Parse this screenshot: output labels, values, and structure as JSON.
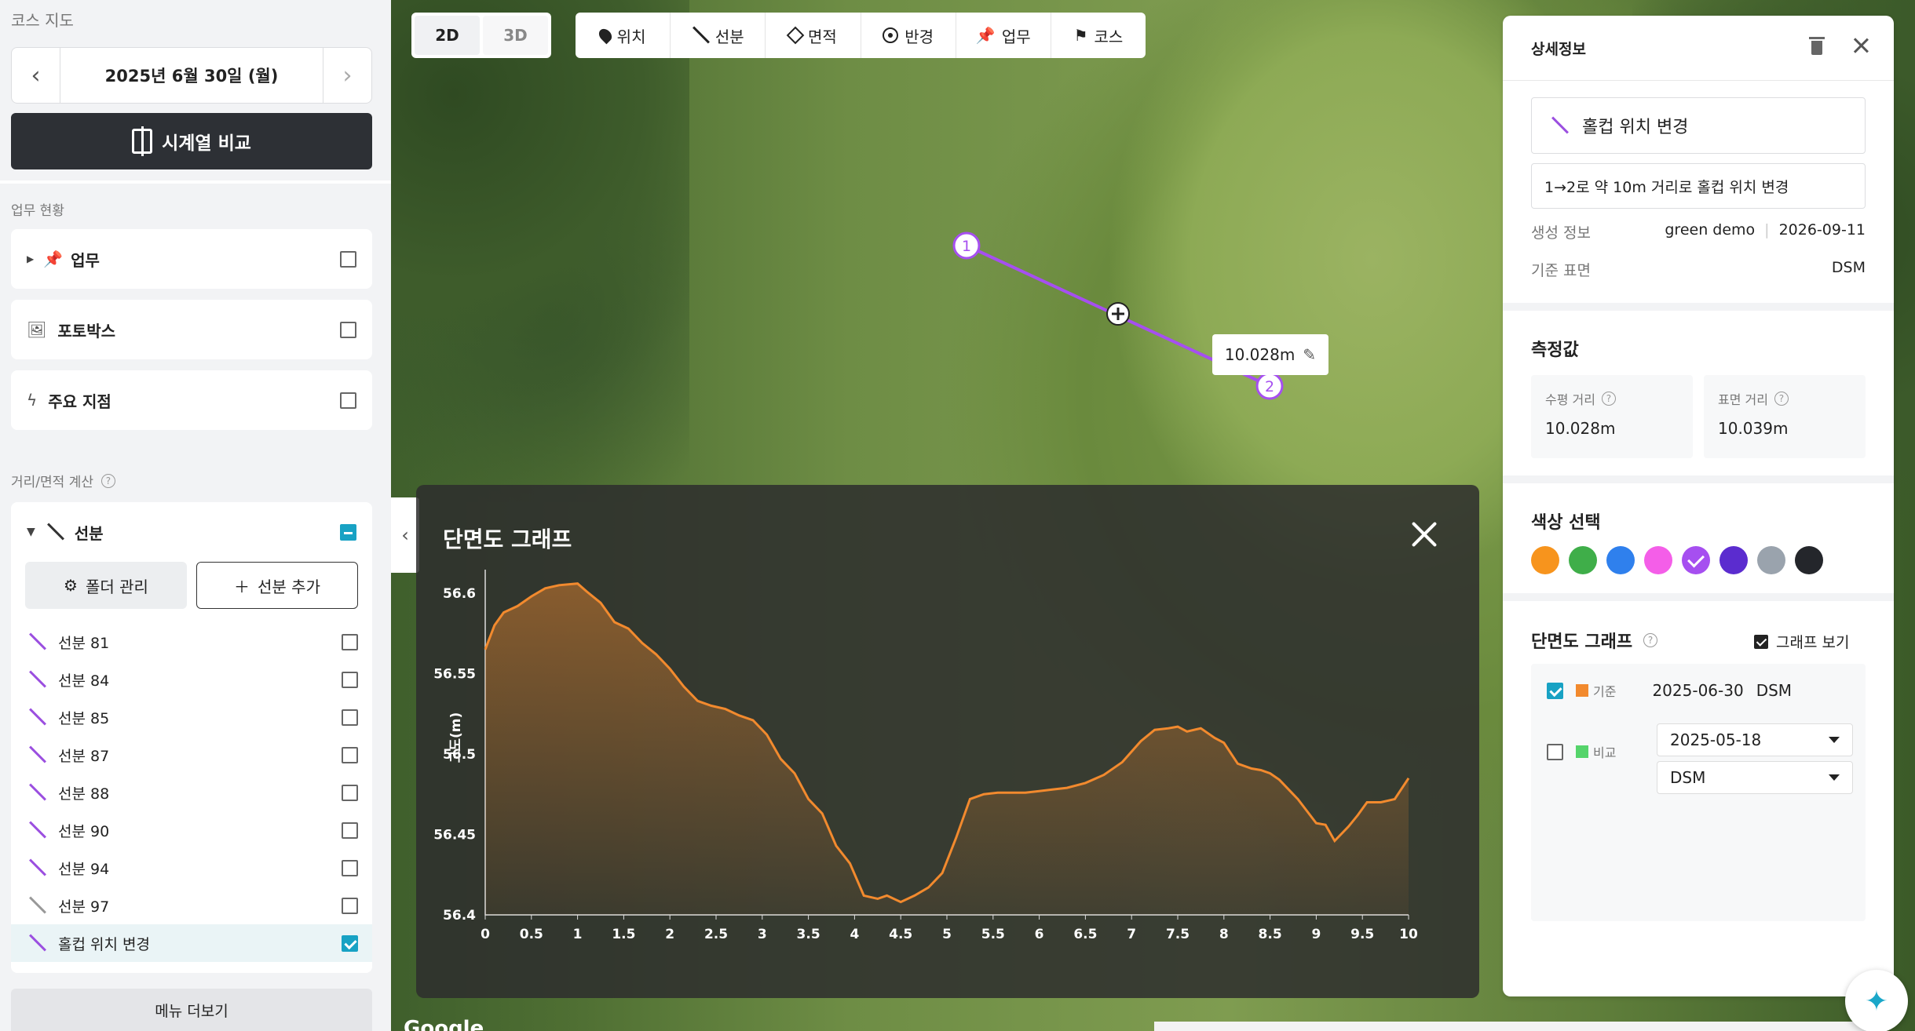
{
  "sidebar": {
    "title": "코스 지도",
    "date": "2025년 6월 30일 (월)",
    "compare_label": "시계열 비교",
    "work_status_label": "업무 현황",
    "cards": [
      {
        "label": "업무"
      },
      {
        "label": "포토박스"
      },
      {
        "label": "주요 지점"
      }
    ],
    "calc_label": "거리/면적 계산",
    "line_panel": {
      "title": "선분",
      "folder_btn": "폴더 관리",
      "add_btn": "선분 추가",
      "items": [
        {
          "name": "선분 81"
        },
        {
          "name": "선분 84"
        },
        {
          "name": "선분 85"
        },
        {
          "name": "선분 87"
        },
        {
          "name": "선분 88"
        },
        {
          "name": "선분 90"
        },
        {
          "name": "선분 94"
        },
        {
          "name": "선분 97"
        },
        {
          "name": "홀컵 위치 변경"
        }
      ]
    },
    "more_label": "메뉴 더보기"
  },
  "map": {
    "view_2d": "2D",
    "view_3d": "3D",
    "tools": [
      "위치",
      "선분",
      "면적",
      "반경",
      "업무",
      "코스"
    ],
    "markers": [
      "1",
      "2"
    ],
    "distance_tag": "10.028m",
    "google": "Google"
  },
  "graph": {
    "title": "단면도 그래프"
  },
  "chart_data": {
    "type": "area",
    "title": "단면도 그래프",
    "ylabel": "고도(m)",
    "xlabel": "",
    "xlim": [
      0,
      10
    ],
    "ylim": [
      56.4,
      56.6
    ],
    "x_ticks": [
      "0",
      "0.5",
      "1",
      "1.5",
      "2",
      "2.5",
      "3",
      "3.5",
      "4",
      "4.5",
      "5",
      "5.5",
      "6",
      "6.5",
      "7",
      "7.5",
      "8",
      "8.5",
      "9",
      "9.5",
      "10"
    ],
    "y_ticks": [
      "56.4",
      "56.45",
      "56.5",
      "56.55",
      "56.6"
    ],
    "series": [
      {
        "color": "#f28a2e",
        "x": [
          0,
          0.1,
          0.2,
          0.35,
          0.5,
          0.65,
          0.8,
          1.0,
          1.1,
          1.25,
          1.4,
          1.55,
          1.7,
          1.85,
          2.0,
          2.15,
          2.3,
          2.45,
          2.6,
          2.75,
          2.9,
          3.05,
          3.2,
          3.35,
          3.5,
          3.65,
          3.8,
          3.95,
          4.1,
          4.25,
          4.35,
          4.5,
          4.65,
          4.8,
          4.95,
          5.1,
          5.25,
          5.4,
          5.55,
          5.7,
          5.85,
          6.0,
          6.15,
          6.3,
          6.5,
          6.7,
          6.9,
          7.1,
          7.25,
          7.4,
          7.5,
          7.6,
          7.75,
          7.9,
          8.0,
          8.15,
          8.3,
          8.4,
          8.5,
          8.6,
          8.8,
          9.0,
          9.1,
          9.2,
          9.35,
          9.45,
          9.55,
          9.7,
          9.85,
          10.0
        ],
        "y": [
          56.565,
          56.58,
          56.588,
          56.592,
          56.598,
          56.603,
          56.605,
          56.606,
          56.601,
          56.594,
          56.582,
          56.578,
          56.569,
          56.562,
          56.553,
          56.542,
          56.533,
          56.53,
          56.528,
          56.524,
          56.521,
          56.512,
          56.497,
          56.488,
          56.472,
          56.463,
          56.443,
          56.432,
          56.412,
          56.41,
          56.412,
          56.408,
          56.412,
          56.417,
          56.426,
          56.448,
          56.472,
          56.475,
          56.476,
          56.476,
          56.476,
          56.477,
          56.478,
          56.479,
          56.482,
          56.487,
          56.495,
          56.508,
          56.515,
          56.516,
          56.517,
          56.514,
          56.516,
          56.51,
          56.507,
          56.494,
          56.491,
          56.49,
          56.488,
          56.484,
          56.472,
          56.457,
          56.456,
          56.446,
          56.455,
          56.462,
          56.47,
          56.47,
          56.472,
          56.485
        ]
      }
    ]
  },
  "detail": {
    "header": "상세정보",
    "name": "홀컵 위치 변경",
    "description": "1→2로 약 10m 거리로 홀컵 위치 변경",
    "created_label": "생성 정보",
    "created_by": "green demo",
    "created_date": "2026-09-11",
    "surface_label": "기준 표면",
    "surface_value": "DSM",
    "measure_title": "측정값",
    "horizontal_label": "수평 거리",
    "horizontal_value": "10.028m",
    "surface_dist_label": "표면 거리",
    "surface_dist_value": "10.039m",
    "color_title": "색상 선택",
    "colors": [
      "#f7941d",
      "#3fae49",
      "#2f80ed",
      "#f45ee8",
      "#a64ff0",
      "#5b2ccf",
      "#9aa3ad",
      "#24262b"
    ],
    "profile_title": "단면도 그래프",
    "graph_view_label": "그래프 보기",
    "base_label": "기준",
    "base_date": "2025-06-30",
    "base_surface": "DSM",
    "compare_label": "비교",
    "compare_date": "2025-05-18",
    "compare_surface": "DSM"
  }
}
